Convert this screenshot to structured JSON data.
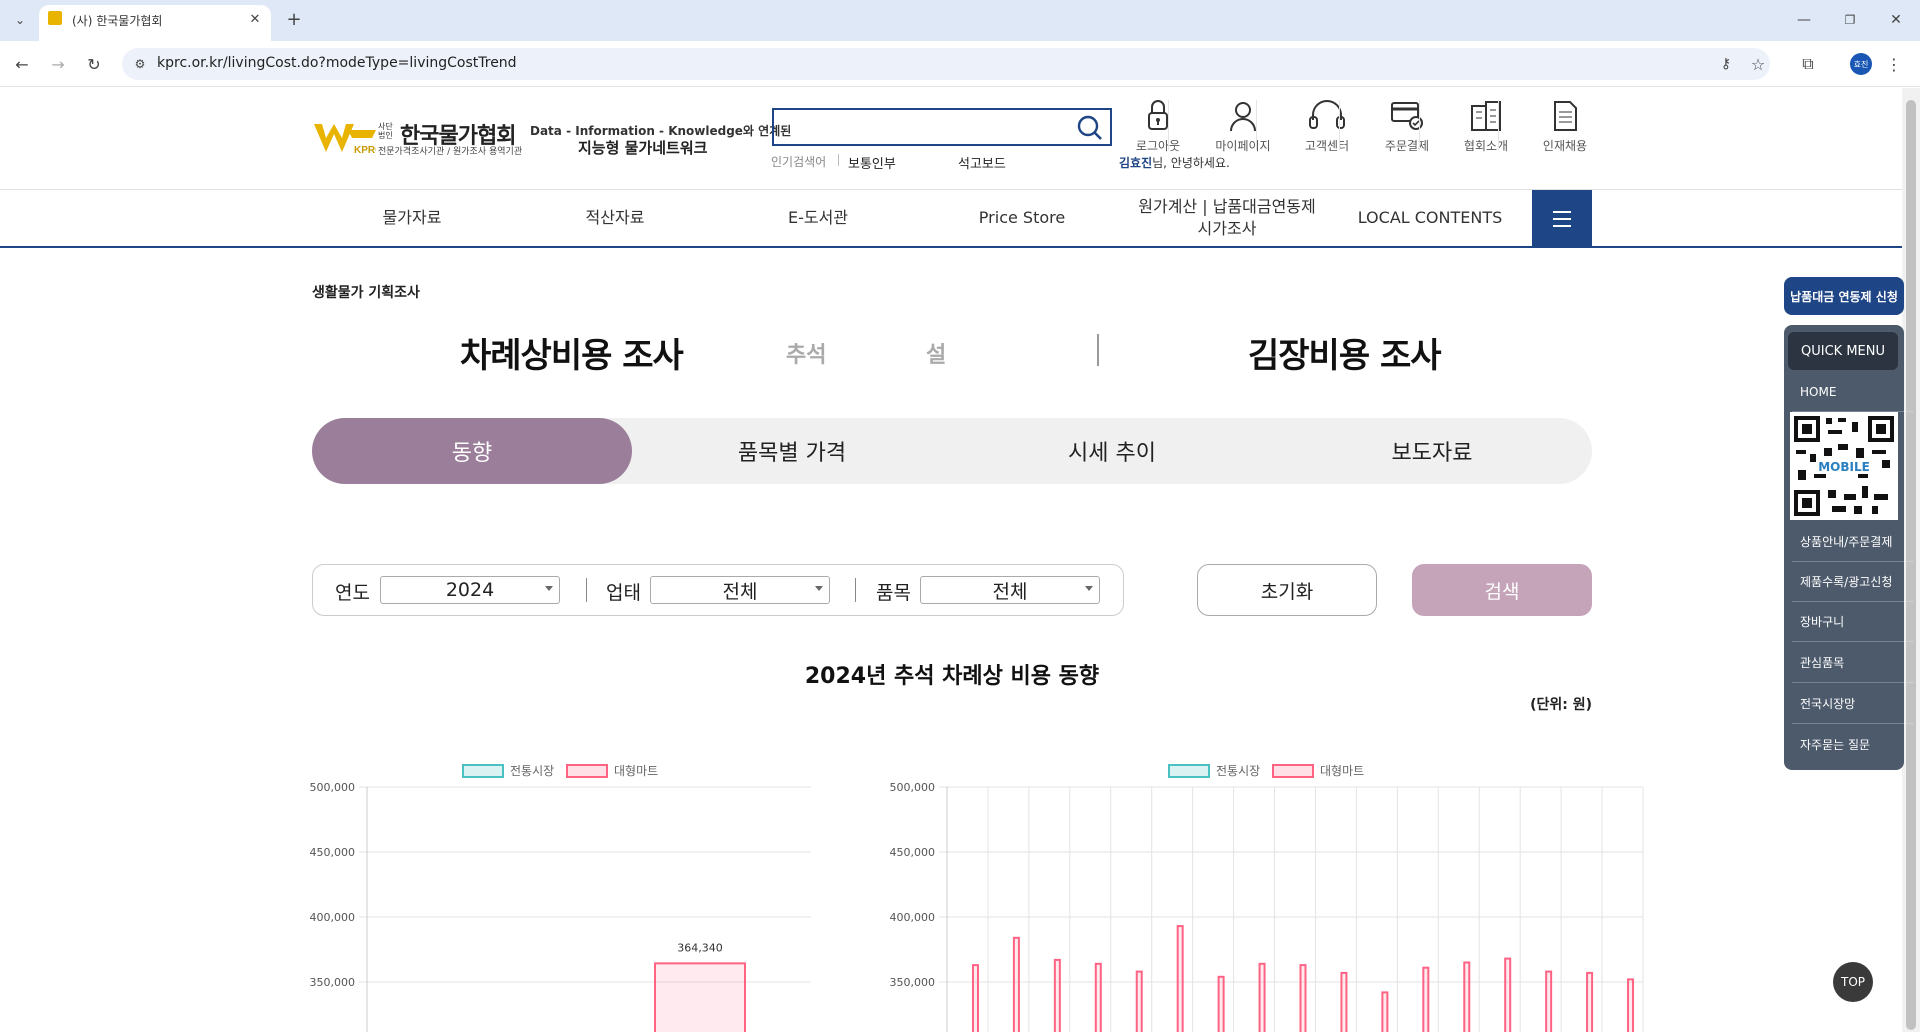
{
  "browser": {
    "tab_title": "(사) 한국물가협회",
    "url": "kprc.or.kr/livingCost.do?modeType=livingCostTrend",
    "profile_initials": "효진",
    "icons": [
      "chevron-down-icon",
      "close-icon",
      "plus-icon",
      "back-icon",
      "forward-icon",
      "reload-icon",
      "site-info-icon",
      "key-icon",
      "star-icon",
      "extensions-icon",
      "kebab-menu-icon"
    ]
  },
  "header": {
    "logo_small_1": "사단 법인",
    "logo_name": "한국물가협회",
    "logo_sub": "전문가격조사기관 / 원가조사 용역기관",
    "tagline_1": "Data - Information - Knowledge와 연계된",
    "tagline_2": "지능형 물가네트워크",
    "search_placeholder": "",
    "popular_label": "인기검색어",
    "popular_1": "보통인부",
    "popular_2": "석고보드",
    "greeting_name": "김효진",
    "greeting_rest": "님, 안녕하세요.",
    "top_icons": [
      {
        "label": "로그아웃",
        "icon": "lock-icon"
      },
      {
        "label": "마이페이지",
        "icon": "user-icon"
      },
      {
        "label": "고객센터",
        "icon": "headset-icon"
      },
      {
        "label": "주문결제",
        "icon": "order-icon"
      },
      {
        "label": "협회소개",
        "icon": "building-icon"
      },
      {
        "label": "인재채용",
        "icon": "document-icon"
      }
    ]
  },
  "nav": {
    "items": [
      "물가자료",
      "적산자료",
      "E-도서관",
      "Price Store",
      "원가계산 | 납품대금연동제\n시가조사",
      "LOCAL CONTENTS"
    ],
    "menu_icon": "hamburger-icon"
  },
  "page": {
    "breadcrumb": "생활물가 기획조사",
    "title_left": "차례상비용 조사",
    "sub_1": "추석",
    "sub_2": "설",
    "title_right": "김장비용 조사",
    "tabs": [
      "동향",
      "품목별 가격",
      "시세 추이",
      "보도자료"
    ],
    "active_tab_color": "#9b7e9a",
    "filter": {
      "year_label": "연도",
      "year_value": "2024",
      "type_label": "업태",
      "type_value": "전체",
      "item_label": "품목",
      "item_value": "전체",
      "reset_label": "초기화",
      "search_label": "검색"
    },
    "section_title": "2024년 추석 차례상 비용 동향",
    "unit_label": "(단위: 원)"
  },
  "quick": {
    "banner": "납품대금 연동제 신청",
    "title": "QUICK MENU",
    "home": "HOME",
    "qr_label": "MOBILE",
    "items": [
      "상품안내/주문결제",
      "제품수록/광고신청",
      "장바구니",
      "관심품목",
      "전국시장망",
      "자주묻는 질문"
    ],
    "top_button": "TOP"
  },
  "chart_data": [
    {
      "type": "bar",
      "series": [
        {
          "name": "전통시장",
          "color": "#4bc0c0",
          "values": []
        },
        {
          "name": "대형마트",
          "color": "#ff6384",
          "values": [
            null,
            364340
          ]
        }
      ],
      "yticks": [
        "500,000",
        "450,000",
        "400,000",
        "350,000"
      ],
      "ylim": [
        300000,
        500000
      ],
      "data_labels": [
        "364,340"
      ]
    },
    {
      "type": "bar",
      "series": [
        {
          "name": "전통시장",
          "color": "#4bc0c0",
          "values": []
        },
        {
          "name": "대형마트",
          "color": "#ff6384",
          "values": [
            363000,
            384000,
            367000,
            364000,
            358000,
            393000,
            354000,
            364000,
            363000,
            357000,
            342000,
            361000,
            365000,
            368000,
            358000,
            357000,
            352000
          ]
        }
      ],
      "yticks": [
        "500,000",
        "450,000",
        "400,000",
        "350,000"
      ],
      "ylim": [
        300000,
        500000
      ]
    }
  ]
}
